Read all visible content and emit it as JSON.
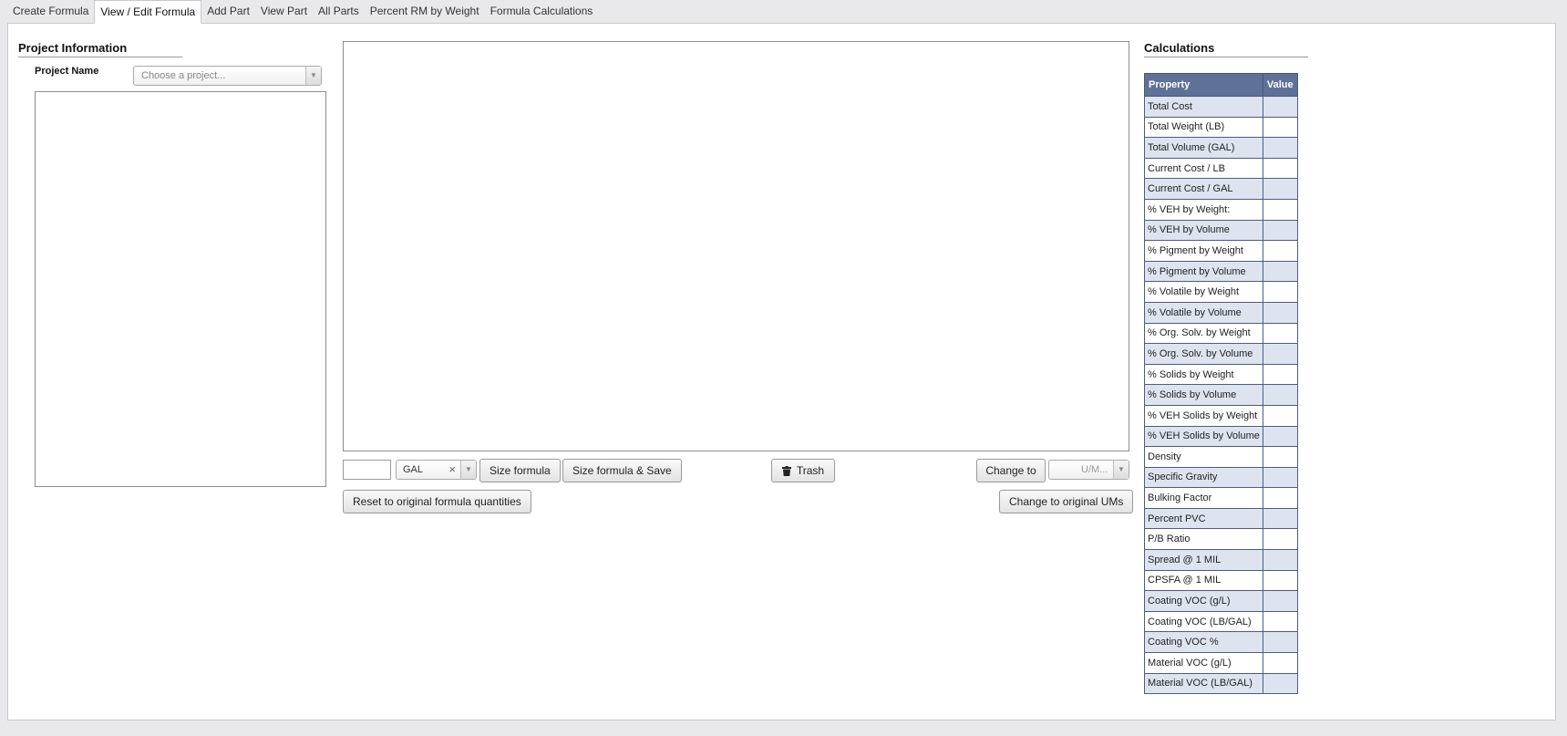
{
  "tabs": [
    {
      "label": "Create Formula"
    },
    {
      "label": "View / Edit Formula",
      "active": true
    },
    {
      "label": "Add Part"
    },
    {
      "label": "View Part"
    },
    {
      "label": "All Parts"
    },
    {
      "label": "Percent RM by Weight"
    },
    {
      "label": "Formula Calculations"
    }
  ],
  "project": {
    "title": "Project Information",
    "name_label": "Project Name",
    "select_placeholder": "Choose a project..."
  },
  "sizing": {
    "quantity_value": "",
    "unit_value": "GAL",
    "clear_glyph": "×",
    "size_formula_label": "Size formula",
    "size_save_label": "Size formula & Save",
    "trash_label": "Trash",
    "change_to_label": "Change to",
    "um_placeholder": "U/M...",
    "reset_label": "Reset to original formula quantities",
    "change_original_label": "Change to original UMs"
  },
  "calculations": {
    "title": "Calculations",
    "col_property": "Property",
    "col_value": "Value",
    "rows": [
      {
        "property": "Total Cost",
        "value": ""
      },
      {
        "property": "Total Weight (LB)",
        "value": ""
      },
      {
        "property": "Total Volume (GAL)",
        "value": ""
      },
      {
        "property": "Current Cost / LB",
        "value": ""
      },
      {
        "property": "Current Cost / GAL",
        "value": ""
      },
      {
        "property": "% VEH by Weight:",
        "value": ""
      },
      {
        "property": "% VEH by Volume",
        "value": ""
      },
      {
        "property": "% Pigment by Weight",
        "value": ""
      },
      {
        "property": "% Pigment by Volume",
        "value": ""
      },
      {
        "property": "% Volatile by Weight",
        "value": ""
      },
      {
        "property": "% Volatile by Volume",
        "value": ""
      },
      {
        "property": "% Org. Solv. by Weight",
        "value": ""
      },
      {
        "property": "% Org. Solv. by Volume",
        "value": ""
      },
      {
        "property": "% Solids by Weight",
        "value": ""
      },
      {
        "property": "% Solids by Volume",
        "value": ""
      },
      {
        "property": "% VEH Solids by Weight",
        "value": ""
      },
      {
        "property": "% VEH Solids by Volume",
        "value": ""
      },
      {
        "property": "Density",
        "value": ""
      },
      {
        "property": "Specific Gravity",
        "value": ""
      },
      {
        "property": "Bulking Factor",
        "value": ""
      },
      {
        "property": "Percent PVC",
        "value": ""
      },
      {
        "property": "P/B Ratio",
        "value": ""
      },
      {
        "property": "Spread @ 1 MIL",
        "value": ""
      },
      {
        "property": "CPSFA @ 1 MIL",
        "value": ""
      },
      {
        "property": "Coating VOC (g/L)",
        "value": ""
      },
      {
        "property": "Coating VOC (LB/GAL)",
        "value": ""
      },
      {
        "property": "Coating VOC %",
        "value": ""
      },
      {
        "property": "Material VOC (g/L)",
        "value": ""
      },
      {
        "property": "Material VOC (LB/GAL)",
        "value": ""
      }
    ]
  }
}
